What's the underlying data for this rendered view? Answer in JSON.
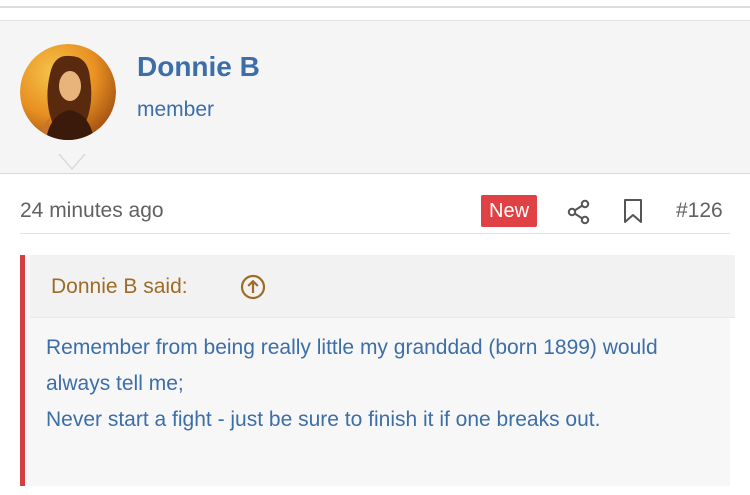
{
  "user": {
    "name": "Donnie B",
    "title": "member",
    "avatar_icon": "user-avatar-photo"
  },
  "post": {
    "timestamp": "24 minutes ago",
    "badge": "New",
    "number": "#126",
    "share_icon": "share-icon",
    "bookmark_icon": "bookmark-icon"
  },
  "quote": {
    "attribution": "Donnie B said:",
    "jump_icon": "arrow-up-circle-icon",
    "lines": [
      "Remember from being really little my granddad (born 1899) would always tell me;",
      "Never start a fight - just be sure to finish it if one breaks out."
    ]
  },
  "colors": {
    "link_blue": "#3c6ea8",
    "badge_red": "#e04144",
    "quote_border": "#d43f43",
    "attribution_brown": "#9c6c28"
  }
}
